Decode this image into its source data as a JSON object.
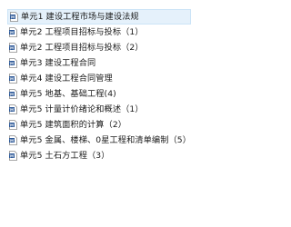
{
  "files": [
    {
      "name": "单元1 建设工程市场与建设法规",
      "icon": "word-doc-icon",
      "selected": true
    },
    {
      "name": "单元2 工程项目招标与投标（1）",
      "icon": "word-doc-icon",
      "selected": false
    },
    {
      "name": "单元2 工程项目招标与投标（2）",
      "icon": "word-doc-icon",
      "selected": false
    },
    {
      "name": "单元3 建设工程合同",
      "icon": "word-doc-icon",
      "selected": false
    },
    {
      "name": "单元4 建设工程合同管理",
      "icon": "word-doc-icon",
      "selected": false
    },
    {
      "name": "单元5 地基、基础工程(4)",
      "icon": "word-doc-icon",
      "selected": false
    },
    {
      "name": "单元5 计量计价绪论和概述（1）",
      "icon": "word-doc-icon",
      "selected": false
    },
    {
      "name": "单元5 建筑面积的计算（2）",
      "icon": "word-doc-icon",
      "selected": false
    },
    {
      "name": "单元5 金属、楼梯、0星工程和清单编制（5）",
      "icon": "word-doc-icon",
      "selected": false
    },
    {
      "name": "单元5 土石方工程（3）",
      "icon": "word-doc-icon",
      "selected": false
    }
  ],
  "colors": {
    "icon_blue": "#2b5797",
    "selection_bg": "#e5f1fb",
    "selection_border": "#cce4f7"
  }
}
